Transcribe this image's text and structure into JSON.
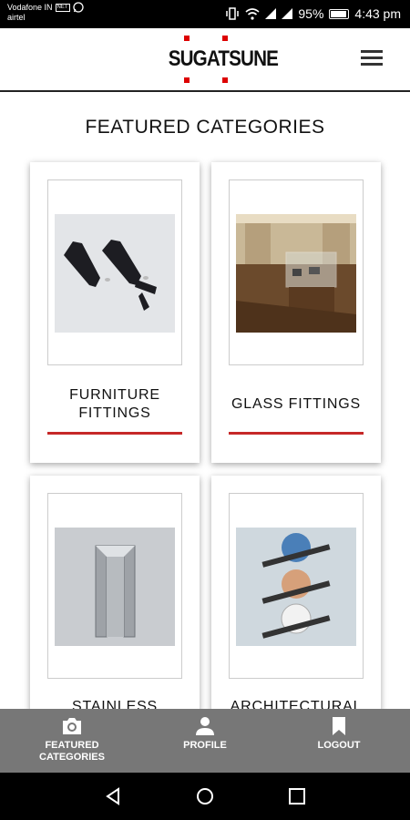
{
  "status_bar": {
    "carrier1": "Vodafone IN",
    "carrier1_badge": "NET",
    "carrier2": "airtel",
    "battery_percent": "95%",
    "time": "4:43 pm"
  },
  "header": {
    "logo_text": "SUGATSUNE",
    "menu_icon": "hamburger-menu-icon"
  },
  "page": {
    "title": "FEATURED CATEGORIES"
  },
  "categories": [
    {
      "label": "FURNITURE FITTINGS",
      "label_line1": "FURNITURE",
      "label_line2": "FITTINGS",
      "image": "black-latch-hardware-photo"
    },
    {
      "label": "GLASS FITTINGS",
      "image": "glass-display-case-photo"
    },
    {
      "label": "STAINLESS",
      "image": "stainless-bracket-photo"
    },
    {
      "label": "ARCHITECTURAL",
      "image": "roller-wheels-photo"
    }
  ],
  "bottom_nav": {
    "items": [
      {
        "label_line1": "FEATURED",
        "label_line2": "CATEGORIES",
        "icon": "camera-icon"
      },
      {
        "label_line1": "PROFILE",
        "icon": "person-icon"
      },
      {
        "label_line1": "LOGOUT",
        "icon": "bookmark-icon"
      }
    ]
  },
  "colors": {
    "accent_red": "#c62828",
    "nav_gray": "#777777"
  }
}
